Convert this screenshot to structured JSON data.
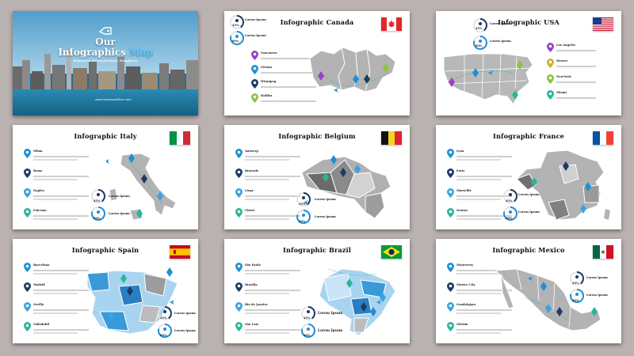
{
  "cover": {
    "title_line1": "Our",
    "title_line2": "Infographics",
    "title_line3": "Map",
    "subtitle": "Business Presentation Template",
    "url": "www.ImpressivePlan.com"
  },
  "placeholder_label": "Lorem Ipsum",
  "gauges": {
    "pct_a": "45%",
    "pct_b": "80%"
  },
  "slides": [
    {
      "title": "Infographic Canada",
      "flag": "canada",
      "cities": [
        "Vancouver",
        "Ottawa",
        "Winnipeg",
        "Halifax"
      ]
    },
    {
      "title": "Infographic USA",
      "flag": "usa",
      "cities": [
        "Los Angeles",
        "Denver",
        "New-York",
        "Miami"
      ]
    },
    {
      "title": "Infographic Italy",
      "flag": "italy",
      "cities": [
        "Milan",
        "Roma",
        "Naples",
        "Palermo"
      ]
    },
    {
      "title": "Infographic Belgium",
      "flag": "belgium",
      "cities": [
        "Antwerp",
        "Brussels",
        "Liege",
        "Ghent"
      ]
    },
    {
      "title": "Infographic France",
      "flag": "france",
      "cities": [
        "Lyon",
        "Paris",
        "Marseille",
        "Nantes"
      ]
    },
    {
      "title": "Infographic Spain",
      "flag": "spain",
      "cities": [
        "Barcelona",
        "Madrid",
        "Sevilla",
        "Valladolid"
      ]
    },
    {
      "title": "Infographic Brazil",
      "flag": "brazil",
      "cities": [
        "São Paulo",
        "Brasília",
        "Rio de Janeiro",
        "São Luís"
      ]
    },
    {
      "title": "Infographic Mexico",
      "flag": "mexico",
      "cities": [
        "Monterrey",
        "Mexico City",
        "Guadalajara",
        "Mérida"
      ]
    }
  ],
  "colors": {
    "background": "#b9b2b0",
    "pin_purple": "#9b3fc4",
    "pin_blue": "#1f8fd6",
    "pin_navy": "#1b3b66",
    "pin_green": "#8dc33f",
    "pin_teal": "#29b69a",
    "map_gray": "#a5a5a5",
    "map_light_blue": "#a9d4f0",
    "map_blue": "#3a9ad9"
  }
}
